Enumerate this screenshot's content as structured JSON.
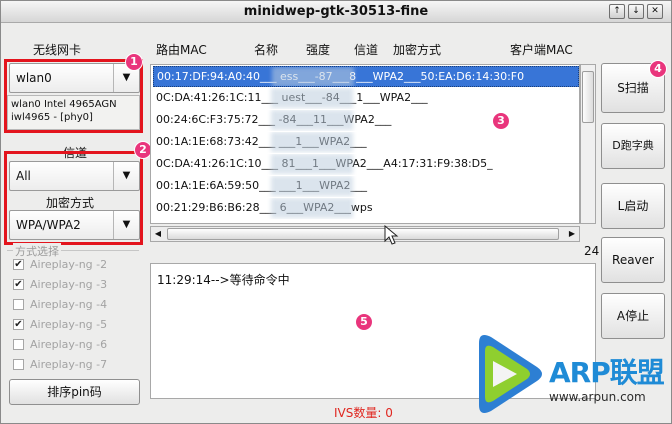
{
  "window": {
    "title": "minidwep-gtk-30513-fine",
    "buttons": [
      "↑",
      "↓",
      "✕"
    ]
  },
  "left": {
    "wireless_label": "无线网卡",
    "interface_value": "wlan0",
    "interface_info": [
      "wlan0 Intel 4965AGN",
      "iwl4965 - [phy0]"
    ],
    "channel_label": "信道",
    "channel_value": "All",
    "encryption_label": "加密方式",
    "encryption_value": "WPA/WPA2",
    "mode_group_title": "方式选择",
    "options": [
      {
        "label": "Aireplay-ng -2",
        "checked": true
      },
      {
        "label": "Aireplay-ng -3",
        "checked": true
      },
      {
        "label": "Aireplay-ng -4",
        "checked": false
      },
      {
        "label": "Aireplay-ng -5",
        "checked": true
      },
      {
        "label": "Aireplay-ng -6",
        "checked": false
      },
      {
        "label": "Aireplay-ng -7",
        "checked": false
      }
    ],
    "sort_button": "排序pin码"
  },
  "columns": [
    "路由MAC",
    "名称",
    "强度",
    "信道",
    "加密方式",
    "客户端MAC"
  ],
  "rows": [
    "00:17:DF:94:A0:40___                    ess___-87___8___WPA2___50:EA:D6:14:30:F0",
    "0C:DA:41:26:1C:11___                  uest___-84___1___WPA2___",
    "00:24:6C:F3:75:72___                    -84___11___WPA2___",
    "00:1A:1E:68:73:42___                    ___1___WPA2___",
    "0C:DA:41:26:1C:10___                  81___1___WPA2___A4:17:31:F9:38:D5_",
    "00:1A:1E:6A:59:50___                   ___1___WPA2___",
    "00:21:29:B6:B6:28___                   6___WPA2___wps"
  ],
  "right_buttons": {
    "scan": "S扫描",
    "dict": "D跑字典",
    "start": "L启动",
    "reaver": "Reaver",
    "stop": "A停止"
  },
  "counter": "24",
  "log_line": "11:29:14-->等待命令中",
  "ivs": "IVS数量: 0",
  "badges": [
    "1",
    "2",
    "3",
    "4",
    "5"
  ],
  "logo": {
    "name": "ARP联盟",
    "url": "www.arpun.com"
  },
  "colors": {
    "accent_red": "#e3141d",
    "badge_pink": "#e9357c",
    "selection": "#3875d7",
    "logo_blue": "#1f8bd6"
  }
}
